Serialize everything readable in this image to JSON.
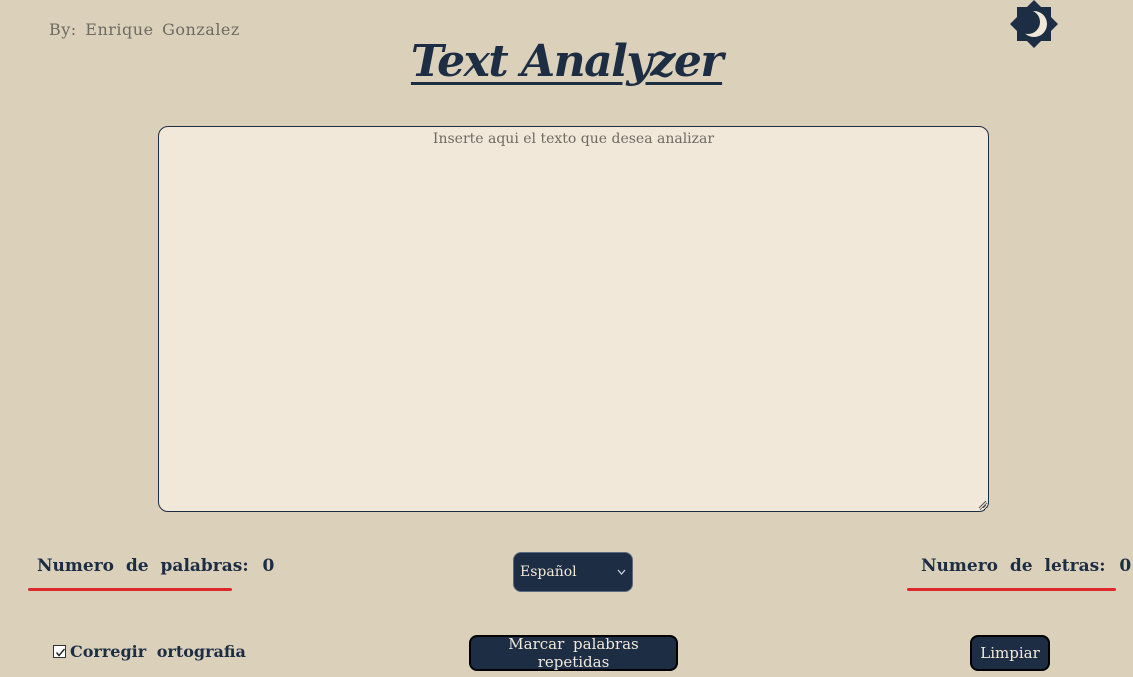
{
  "header": {
    "author": "By:  Enrique  Gonzalez",
    "title": "Text Analyzer",
    "theme_toggle_icon": "moon-sun-icon"
  },
  "editor": {
    "placeholder": "Inserte aqui el texto que desea analizar",
    "value": ""
  },
  "stats": {
    "words_label": "Numero de palabras:",
    "words_value": "0",
    "letters_label": "Numero de letras:",
    "letters_value": "0"
  },
  "language": {
    "selected": "Español",
    "options": [
      "Español"
    ]
  },
  "controls": {
    "spellcheck_label": "Corregir ortografia",
    "spellcheck_checked": true,
    "mark_repeated_label": "Marcar palabras repetidas",
    "clear_label": "Limpiar"
  },
  "colors": {
    "background": "#dbd1bb",
    "accent": "#1d2d44",
    "editor_bg": "#f1e8d9",
    "underline": "#e0262d"
  }
}
